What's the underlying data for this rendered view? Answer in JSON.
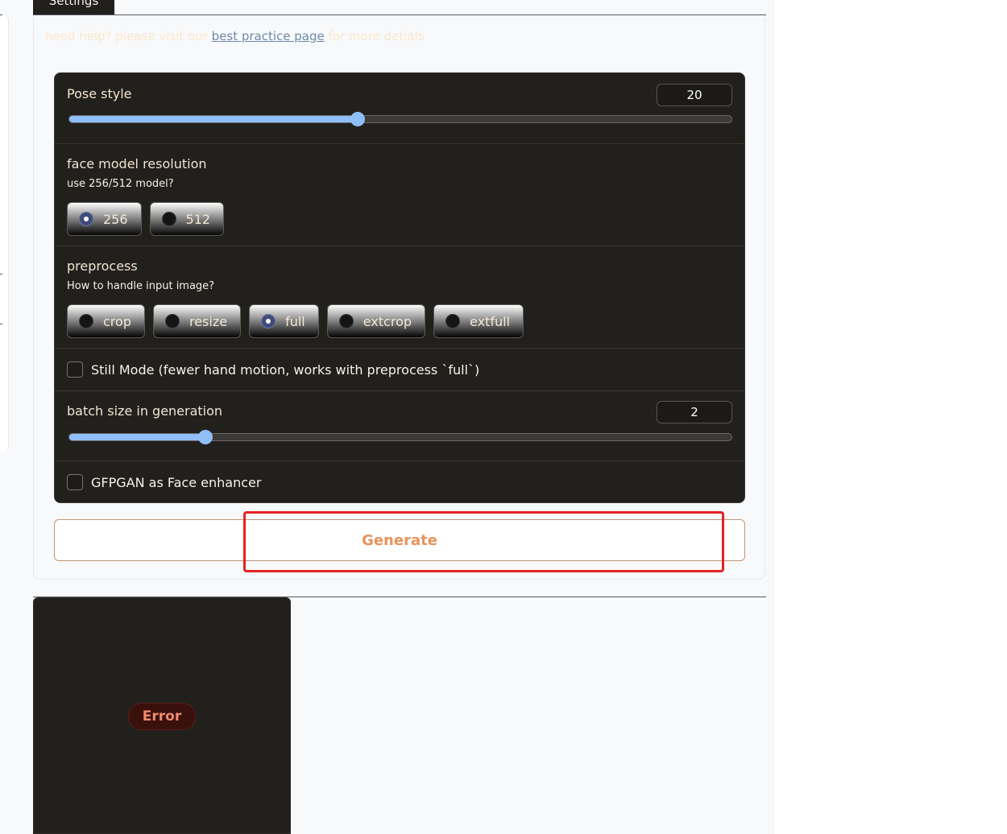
{
  "tabs": {
    "active_label": "Settings"
  },
  "help": {
    "prefix": "need help? please visit our",
    "link_text": "best practice page",
    "suffix": "for more detials"
  },
  "pose_style": {
    "label": "Pose style",
    "value": "20",
    "fraction": 0.436
  },
  "face_model": {
    "label": "face model resolution",
    "hint": "use 256/512 model?",
    "options": [
      "256",
      "512"
    ],
    "selected": "256"
  },
  "preprocess": {
    "label": "preprocess",
    "hint": "How to handle input image?",
    "options": [
      "crop",
      "resize",
      "full",
      "extcrop",
      "extfull"
    ],
    "selected": "full"
  },
  "still_mode": {
    "label": "Still Mode (fewer hand motion, works with preprocess `full`)",
    "checked": false
  },
  "batch_size": {
    "label": "batch size in generation",
    "value": "2",
    "fraction": 0.206
  },
  "gfpgan": {
    "label": "GFPGAN as Face enhancer",
    "checked": false
  },
  "generate": {
    "label": "Generate"
  },
  "output": {
    "error_label": "Error"
  },
  "colors": {
    "accent": "#8fbef9",
    "generate_text": "#e7935b",
    "highlight": "#e52222",
    "panel_dark": "#22201d"
  }
}
